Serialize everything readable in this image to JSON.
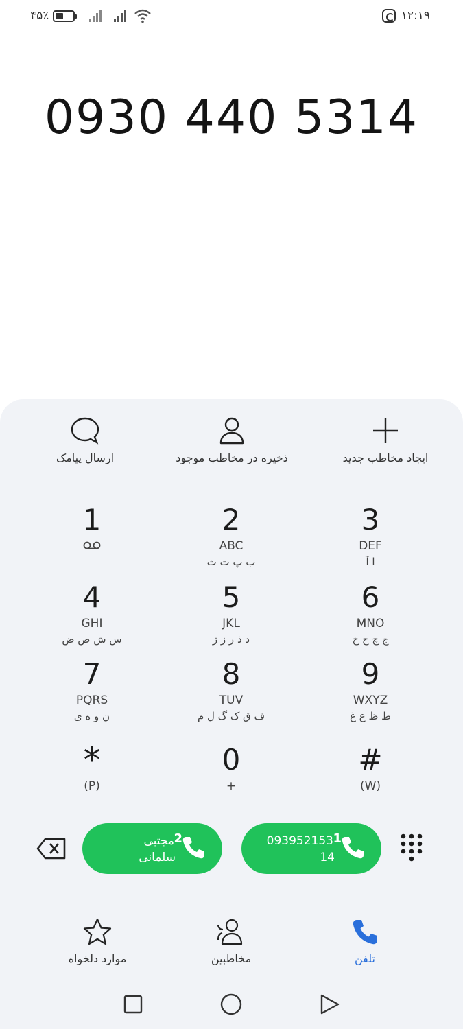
{
  "status_bar": {
    "battery_text": "۴۵٪",
    "battery_level": 0.45,
    "time": "۱۲:۱۹",
    "icons": [
      "battery-icon",
      "signal-icon",
      "signal-icon",
      "wifi-icon",
      "app-notification-icon"
    ]
  },
  "dialer": {
    "number": "0930 440 5314"
  },
  "actions": {
    "send_sms": "ارسال پیامک",
    "save_existing": "ذخیره در مخاطب موجود",
    "create_new": "ایجاد مخاطب جدید"
  },
  "keypad": {
    "k1": {
      "digit": "1",
      "sub": "",
      "sub2": ""
    },
    "k2": {
      "digit": "2",
      "sub": "ABC",
      "sub2": "ب پ ت ث"
    },
    "k3": {
      "digit": "3",
      "sub": "DEF",
      "sub2": "ا آ"
    },
    "k4": {
      "digit": "4",
      "sub": "GHI",
      "sub2": "س ش ص ض"
    },
    "k5": {
      "digit": "5",
      "sub": "JKL",
      "sub2": "د ذ ر ز ژ"
    },
    "k6": {
      "digit": "6",
      "sub": "MNO",
      "sub2": "ج چ ح خ"
    },
    "k7": {
      "digit": "7",
      "sub": "PQRS",
      "sub2": "ن و ه ی"
    },
    "k8": {
      "digit": "8",
      "sub": "TUV",
      "sub2": "ف ق ک گ ل م"
    },
    "k9": {
      "digit": "9",
      "sub": "WXYZ",
      "sub2": "ط ظ ع غ"
    },
    "kstar": {
      "digit": "*",
      "sub": "(P)"
    },
    "k0": {
      "digit": "0",
      "sub": "+"
    },
    "khash": {
      "digit": "#",
      "sub": "(W)"
    }
  },
  "calls": {
    "sim2": {
      "sim": "2",
      "line1": "مجتبی",
      "line2": "سلمانی"
    },
    "sim1": {
      "sim": "1",
      "line1": "093952153",
      "line2": "14"
    }
  },
  "tabs": {
    "favorites": "موارد دلخواه",
    "contacts": "مخاطبین",
    "phone": "تلفن"
  },
  "colors": {
    "accent": "#2a6fdb",
    "call_green": "#20c25a",
    "panel_bg": "#f1f3f7"
  }
}
